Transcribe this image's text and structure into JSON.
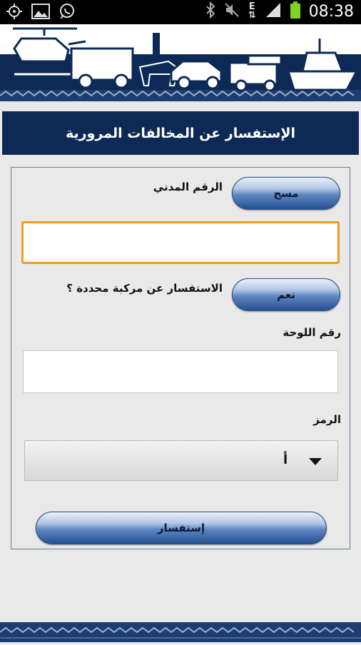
{
  "status_bar": {
    "time": "08:38",
    "left_icons": [
      "location-icon",
      "image-icon",
      "whatsapp-icon"
    ],
    "right_icons": [
      "bluetooth-icon",
      "mute-icon",
      "data-e-icon",
      "signal-icon",
      "battery-icon"
    ],
    "network_type": "E"
  },
  "header": {
    "title": "الإستفسار عن المخالفات المرورية"
  },
  "form": {
    "civil_id": {
      "label": "الرقم المدني",
      "clear_button": "مسح",
      "value": ""
    },
    "vehicle_question": {
      "label": "الاستفسار عن مركبة محددة ؟",
      "yes_button": "نعم"
    },
    "plate": {
      "label": "رقم اللوحة",
      "value": ""
    },
    "code": {
      "label": "الرمز",
      "selected": "أ"
    },
    "submit_button": "إستفسار"
  },
  "colors": {
    "navy": "#0c2a55",
    "focus_orange": "#f39b1f",
    "background": "#e9e9ea"
  }
}
